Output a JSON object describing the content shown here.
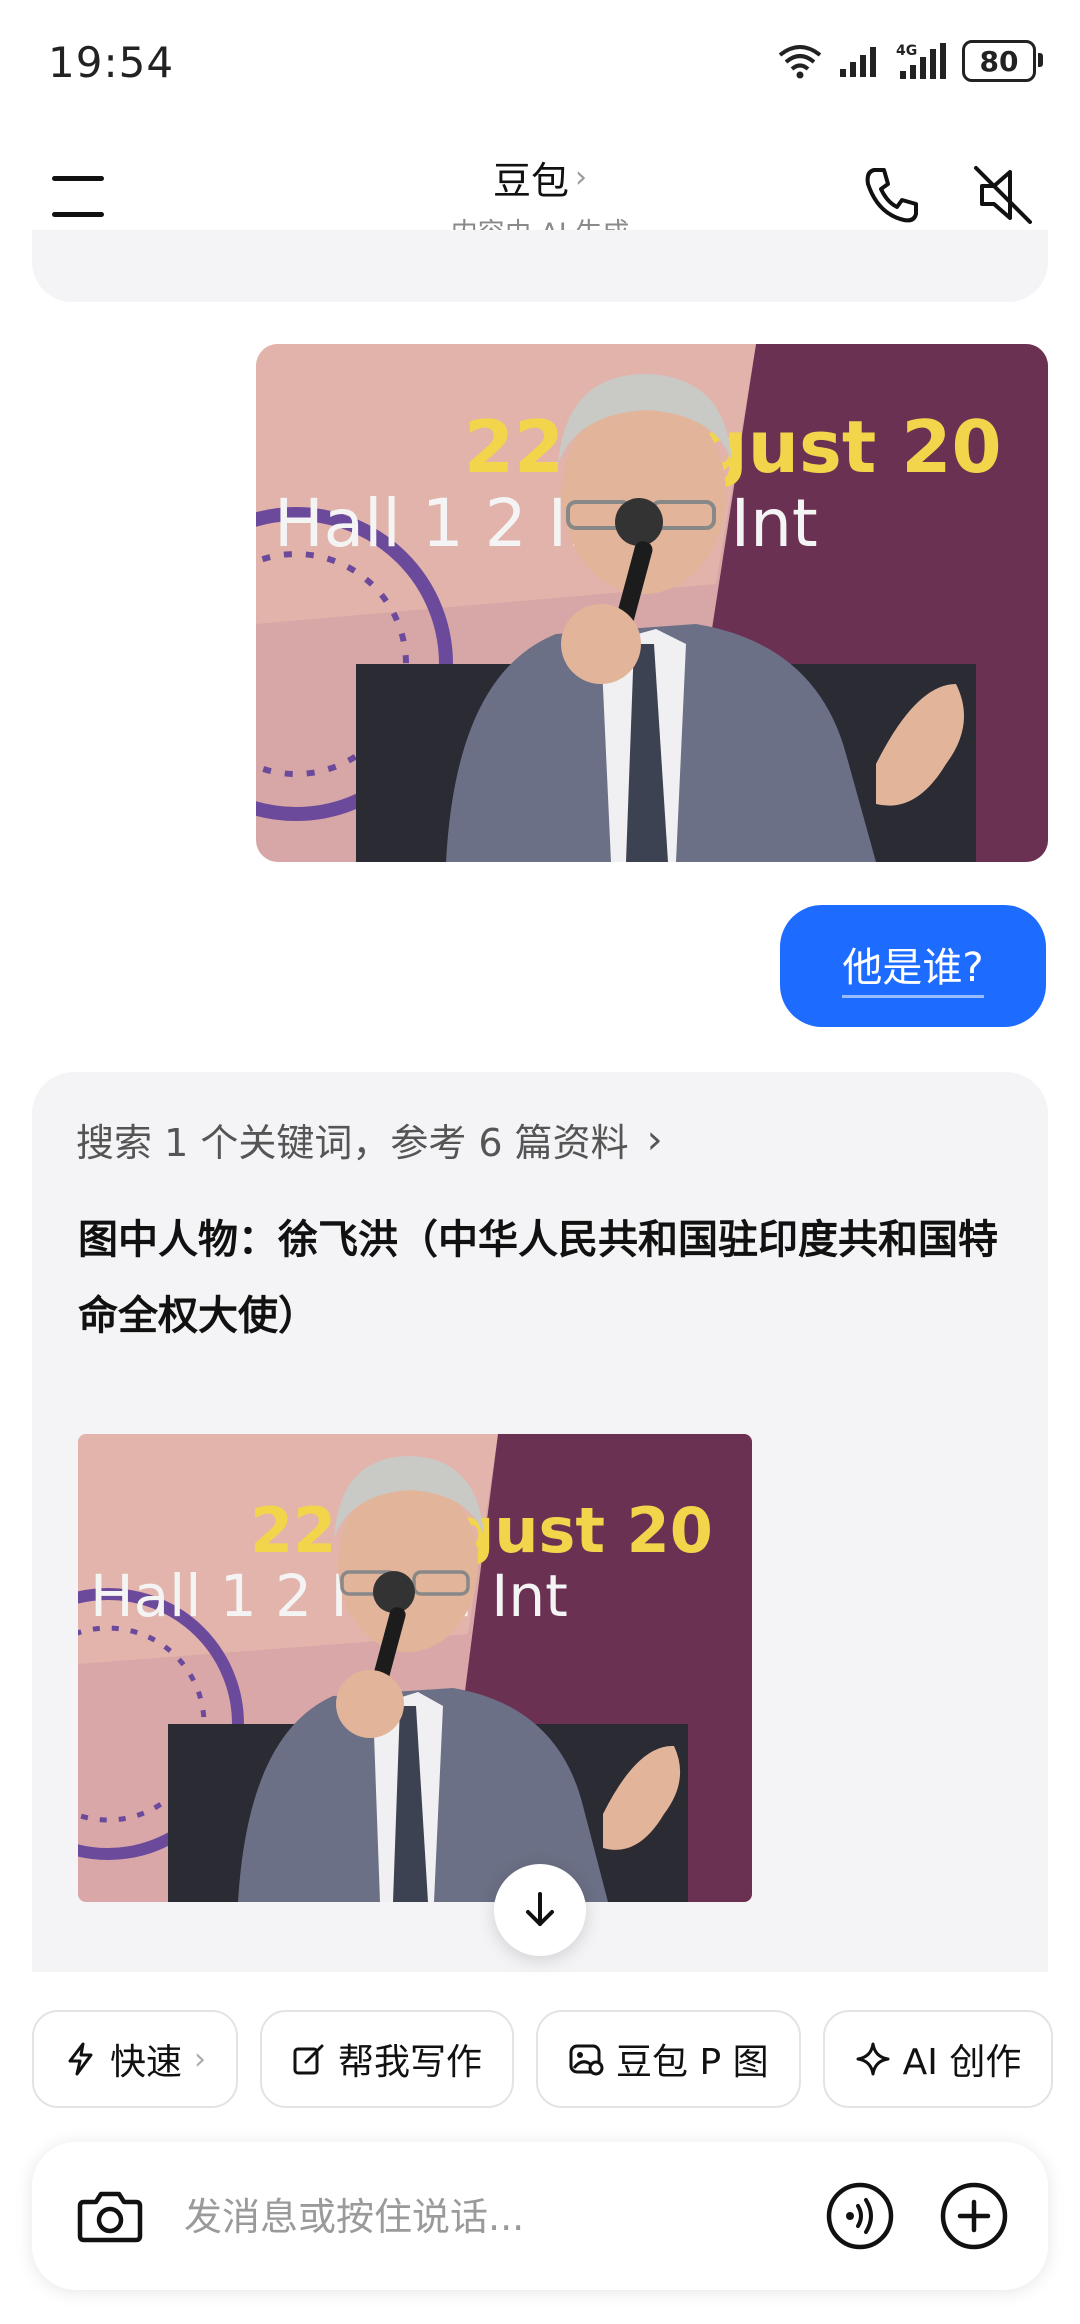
{
  "status_bar": {
    "time": "19:54",
    "battery": "80",
    "network": "4G"
  },
  "header": {
    "title": "豆包",
    "subtitle": "内容由 AI 生成"
  },
  "chat": {
    "user_image": {
      "text_line1": "22 August 20",
      "text_line2": "Hall 1 2 India Int"
    },
    "user_message": "他是谁?",
    "answer": {
      "search_summary": "搜索 1 个关键词，参考 6 篇资料",
      "text": "图中人物：徐飞洪（中华人民共和国驻印度共和国特命全权大使）",
      "image": {
        "text_line1": "22 August 20",
        "text_line2": "Hall 1 2 India Int"
      }
    }
  },
  "quick_actions": [
    {
      "label": "快速",
      "icon": "lightning-icon"
    },
    {
      "label": "帮我写作",
      "icon": "edit-icon"
    },
    {
      "label": "豆包 P 图",
      "icon": "image-edit-icon"
    },
    {
      "label": "AI 创作",
      "icon": "sparkle-icon"
    }
  ],
  "input": {
    "placeholder": "发消息或按住说话..."
  },
  "colors": {
    "accent": "#1e6cff",
    "card_bg": "#f4f4f6"
  }
}
